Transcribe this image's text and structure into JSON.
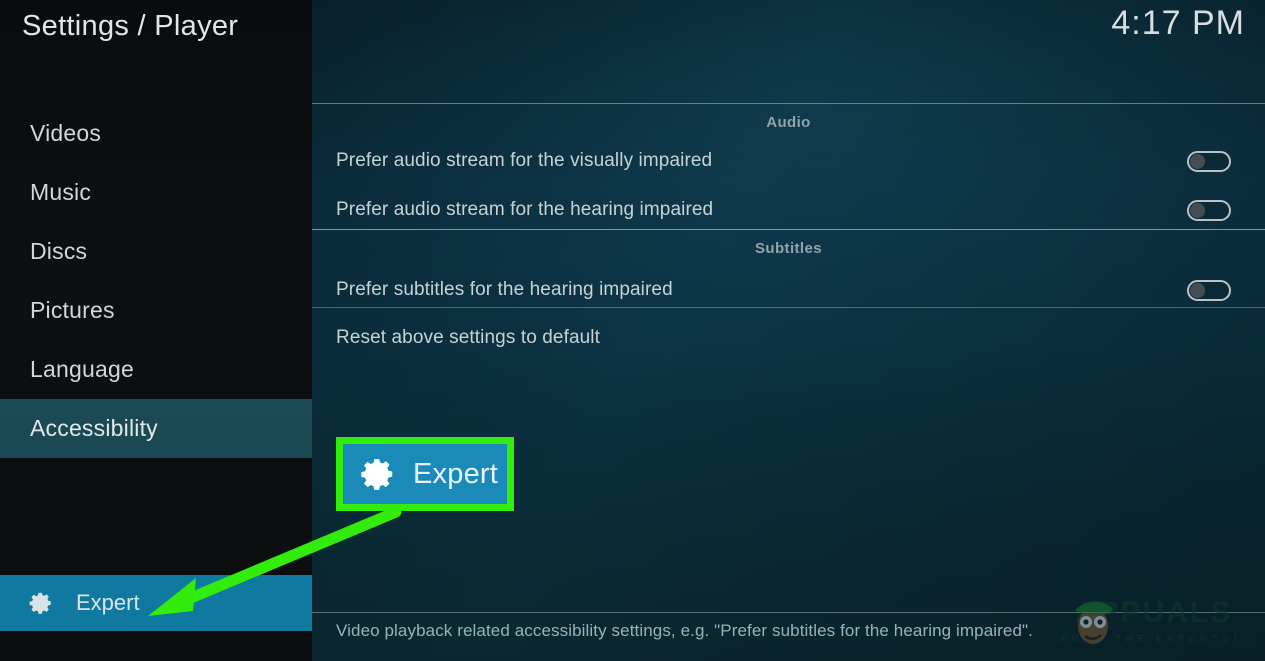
{
  "header": {
    "title": "Settings / Player",
    "clock": "4:17 PM"
  },
  "sidebar": {
    "items": [
      {
        "label": "Videos",
        "selected": false
      },
      {
        "label": "Music",
        "selected": false
      },
      {
        "label": "Discs",
        "selected": false
      },
      {
        "label": "Pictures",
        "selected": false
      },
      {
        "label": "Language",
        "selected": false
      },
      {
        "label": "Accessibility",
        "selected": true
      }
    ],
    "expert_button": {
      "label": "Expert",
      "icon": "gear-icon"
    }
  },
  "main": {
    "sections": [
      {
        "heading": "Audio",
        "rows": [
          {
            "label": "Prefer audio stream for the visually impaired",
            "control": "toggle",
            "value": "off"
          },
          {
            "label": "Prefer audio stream for the hearing impaired",
            "control": "toggle",
            "value": "off"
          }
        ]
      },
      {
        "heading": "Subtitles",
        "rows": [
          {
            "label": "Prefer subtitles for the hearing impaired",
            "control": "toggle",
            "value": "off"
          },
          {
            "label": "Reset above settings to default",
            "control": "none",
            "value": ""
          }
        ]
      }
    ]
  },
  "callout": {
    "label": "Expert",
    "icon": "gear-icon",
    "border_color": "#32ec0c",
    "background_color": "#1a8bb8",
    "arrow_color": "#32ec0c"
  },
  "footer": {
    "description": "Video playback related accessibility settings, e.g. \"Prefer subtitles for the hearing impaired\"."
  },
  "watermark": {
    "brand": "APPUALS",
    "tagline": "FROM THE EXPERTS!"
  },
  "colors": {
    "accent_teal": "#1079a0",
    "selected_item": "#1b4a54",
    "text_primary": "#cfd8dc",
    "text_muted": "#93a3a9",
    "highlight_green": "#32ec0c"
  }
}
